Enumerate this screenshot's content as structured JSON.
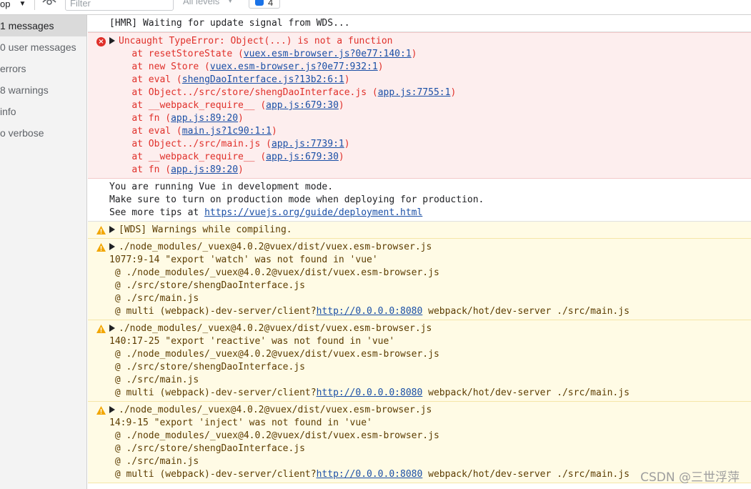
{
  "toolbar": {
    "context": "op",
    "filter_placeholder": "Filter",
    "levels": "All levels",
    "issues_count": "4"
  },
  "sidebar": {
    "items": [
      {
        "label": "1 messages"
      },
      {
        "label": "0 user messages"
      },
      {
        "label": "errors"
      },
      {
        "label": "8 warnings"
      },
      {
        "label": "info"
      },
      {
        "label": "o verbose"
      }
    ]
  },
  "console": {
    "hmr": "[HMR] Waiting for update signal from WDS...",
    "error": {
      "title": "Uncaught TypeError: Object(...) is not a function",
      "stack": [
        {
          "pre": "at resetStoreState (",
          "link": "vuex.esm-browser.js?0e77:140:1",
          "post": ")"
        },
        {
          "pre": "at new Store (",
          "link": "vuex.esm-browser.js?0e77:932:1",
          "post": ")"
        },
        {
          "pre": "at eval (",
          "link": "shengDaoInterface.js?13b2:6:1",
          "post": ")"
        },
        {
          "pre": "at Object../src/store/shengDaoInterface.js (",
          "link": "app.js:7755:1",
          "post": ")"
        },
        {
          "pre": "at __webpack_require__ (",
          "link": "app.js:679:30",
          "post": ")"
        },
        {
          "pre": "at fn (",
          "link": "app.js:89:20",
          "post": ")"
        },
        {
          "pre": "at eval (",
          "link": "main.js?1c90:1:1",
          "post": ")"
        },
        {
          "pre": "at Object../src/main.js (",
          "link": "app.js:7739:1",
          "post": ")"
        },
        {
          "pre": "at __webpack_require__ (",
          "link": "app.js:679:30",
          "post": ")"
        },
        {
          "pre": "at fn (",
          "link": "app.js:89:20",
          "post": ")"
        }
      ]
    },
    "vue_dev": {
      "line1": "You are running Vue in development mode.",
      "line2": "Make sure to turn on production mode when deploying for production.",
      "line3_pre": "See more tips at ",
      "line3_link": "https://vuejs.org/guide/deployment.html"
    },
    "wds_warning": "[WDS] Warnings while compiling.",
    "warnings": [
      {
        "module": "./node_modules/_vuex@4.0.2@vuex/dist/vuex.esm-browser.js",
        "detail": "1077:9-14 \"export 'watch' was not found in 'vue'",
        "req1": " @ ./node_modules/_vuex@4.0.2@vuex/dist/vuex.esm-browser.js",
        "req2": " @ ./src/store/shengDaoInterface.js",
        "req3": " @ ./src/main.js",
        "multi_pre": " @ multi (webpack)-dev-server/client?",
        "multi_link": "http://0.0.0.0:8080",
        "multi_post": " webpack/hot/dev-server ./src/main.js"
      },
      {
        "module": "./node_modules/_vuex@4.0.2@vuex/dist/vuex.esm-browser.js",
        "detail": "140:17-25 \"export 'reactive' was not found in 'vue'",
        "req1": " @ ./node_modules/_vuex@4.0.2@vuex/dist/vuex.esm-browser.js",
        "req2": " @ ./src/store/shengDaoInterface.js",
        "req3": " @ ./src/main.js",
        "multi_pre": " @ multi (webpack)-dev-server/client?",
        "multi_link": "http://0.0.0.0:8080",
        "multi_post": " webpack/hot/dev-server ./src/main.js"
      },
      {
        "module": "./node_modules/_vuex@4.0.2@vuex/dist/vuex.esm-browser.js",
        "detail": "14:9-15 \"export 'inject' was not found in 'vue'",
        "req1": " @ ./node_modules/_vuex@4.0.2@vuex/dist/vuex.esm-browser.js",
        "req2": " @ ./src/store/shengDaoInterface.js",
        "req3": " @ ./src/main.js",
        "multi_pre": " @ multi (webpack)-dev-server/client?",
        "multi_link": "http://0.0.0.0:8080",
        "multi_post": " webpack/hot/dev-server ./src/main.js"
      }
    ]
  },
  "watermark": "CSDN @三世浮萍",
  "colors": {
    "error_text": "#e0302a",
    "error_bg": "#fdeeee",
    "warning_bg": "#fffbe5",
    "warning_icon": "#f2a600",
    "link": "#1a4fa6"
  }
}
